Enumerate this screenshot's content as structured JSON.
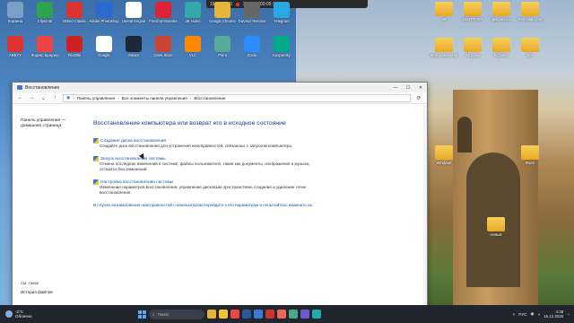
{
  "recording": {
    "resolution": "1920x1080",
    "label": "Запись [00:05:18]"
  },
  "desktop_icons": [
    {
      "label": "Корзина",
      "color": "#7aa0c8"
    },
    {
      "label": "ClipGrab",
      "color": "#2ea44f"
    },
    {
      "label": "XMind Classic",
      "color": "#d33"
    },
    {
      "label": "Adobe Photoshop",
      "color": "#2a6ad1"
    },
    {
      "label": "Unreal Engine",
      "color": "#fff"
    },
    {
      "label": "FreeCommander",
      "color": "#d23"
    },
    {
      "label": "4K Video",
      "color": "#3aa"
    },
    {
      "label": "Google Chrome",
      "color": "#e8b33a"
    },
    {
      "label": "DaVinci Resolve",
      "color": "#666"
    },
    {
      "label": "Telegram",
      "color": "#29a9e1"
    },
    {
      "label": "ABBYY",
      "color": "#d33"
    },
    {
      "label": "Яндекс Браузер",
      "color": "#e44"
    },
    {
      "label": "FileZilla",
      "color": "#c22"
    },
    {
      "label": "Google",
      "color": "#fff"
    },
    {
      "label": "Steam",
      "color": "#1b2838"
    },
    {
      "label": "Geek Store",
      "color": "#c43"
    },
    {
      "label": "VLC",
      "color": "#f80"
    },
    {
      "label": "Paint",
      "color": "#5a9"
    },
    {
      "label": "Zoom",
      "color": "#2d8cff"
    },
    {
      "label": "Kaspersky",
      "color": "#0a8"
    }
  ],
  "right_icons": [
    {
      "label": "ett"
    },
    {
      "label": "ВЫГРУЗКА"
    },
    {
      "label": "Документы"
    },
    {
      "label": "Рабочий стол"
    },
    {
      "label": "Мой компьютер"
    },
    {
      "label": "Загрузки"
    },
    {
      "label": "bigfolder"
    },
    {
      "label": "Бот"
    },
    {
      "label": "Windows"
    },
    {
      "label": "Файл"
    },
    {
      "label": "Новый"
    }
  ],
  "window": {
    "title": "Восстановление",
    "address": [
      "Панель управления",
      "Все элементы панели управления",
      "Восстановление"
    ],
    "left": {
      "home_link_line1": "Панель управления —",
      "home_link_line2": "домашняя страница",
      "see_also": "См. также",
      "history_link": "История файлов"
    },
    "main": {
      "heading": "Восстановление компьютера или возврат его в исходное состояние",
      "items": [
        {
          "link": "Создание диска восстановления",
          "desc": "Создайте диск восстановления для устранения неисправностей, связанных с запуском компьютера."
        },
        {
          "link": "Запуск восстановления системы",
          "desc": "Отмена последних изменений в системе; файлы пользователя, такие как документы, изображения и музыка, остаются без изменений."
        },
        {
          "link": "Настройка восстановления системы",
          "desc": "Изменение параметров восстановления, управление дисковым пространством, создание и удаление точек восстановления."
        }
      ],
      "help": "В случае возникновения неисправностей с компьютером перейдите к его параметрам и попытайтесь изменить их."
    }
  },
  "taskbar": {
    "temperature": "-2°C",
    "weather": "Облачно",
    "search_placeholder": "Поиск",
    "lang": "РУС",
    "time": "4:38",
    "date": "16.12.2025"
  }
}
